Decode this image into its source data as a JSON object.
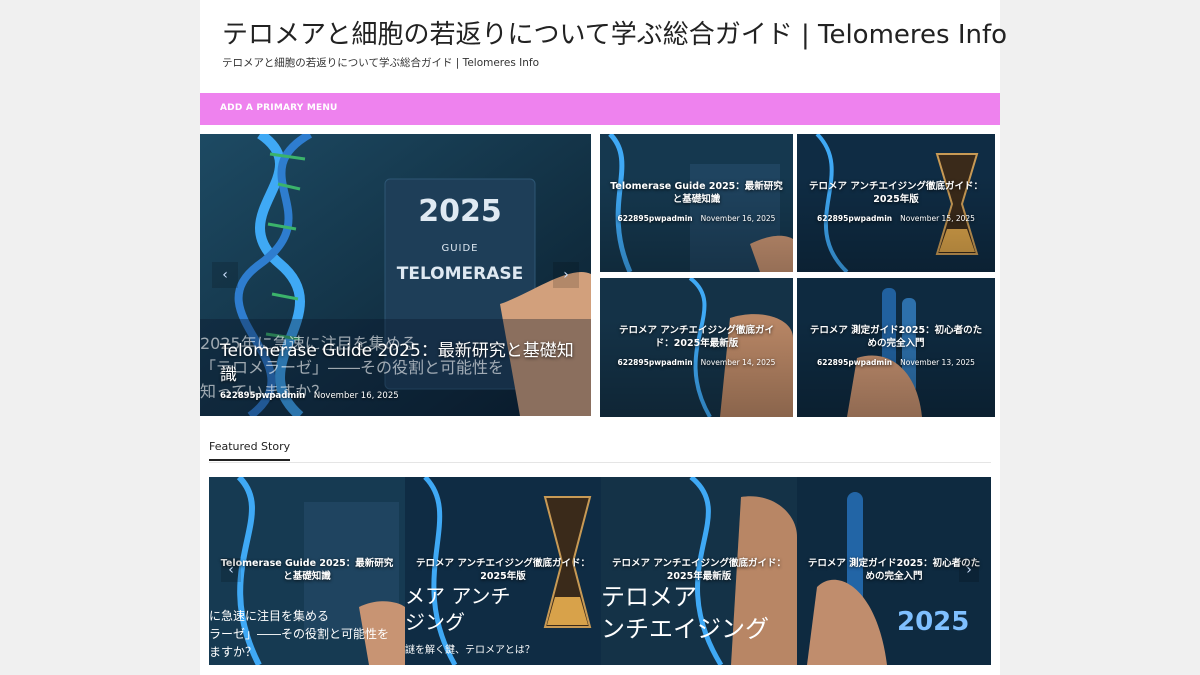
{
  "site": {
    "title": "テロメアと細胞の若返りについて学ぶ総合ガイド | Telomeres Info",
    "description": "テロメアと細胞の若返りについて学ぶ総合ガイド | Telomeres Info"
  },
  "menu": {
    "label": "ADD A PRIMARY MENU"
  },
  "colors": {
    "menu_bar": "#ee82ee",
    "page_bg": "#f0f0f0"
  },
  "hero": {
    "title": "Telomerase Guide 2025：最新研究と基礎知識",
    "author": "622895pwpadmin",
    "date": "November 16, 2025",
    "book_year": "2025",
    "book_guide": "GUIDE",
    "book_name": "TELOMERASE",
    "overlay_line1": "2025年に急速に注目を集める",
    "overlay_line2": "「テロメラーゼ」――その役割と可能性を",
    "overlay_line3": "知っていますか？"
  },
  "grid": [
    {
      "title": "Telomerase Guide 2025：最新研究と基礎知識",
      "author": "622895pwpadmin",
      "date": "November 16, 2025"
    },
    {
      "title": "テロメア アンチエイジング徹底ガイド：2025年版",
      "author": "622895pwpadmin",
      "date": "November 15, 2025"
    },
    {
      "title": "テロメア アンチエイジング徹底ガイド：2025年最新版",
      "author": "622895pwpadmin",
      "date": "November 14, 2025"
    },
    {
      "title": "テロメア 測定ガイド2025：初心者のための完全入門",
      "author": "622895pwpadmin",
      "date": "November 13, 2025"
    }
  ],
  "featured": {
    "heading": "Featured Story",
    "items": [
      {
        "title": "Telomerase Guide 2025：最新研究と基礎知識",
        "caption1": "に急速に注目を集める",
        "caption2": "ラーゼ」――その役割と可能性を",
        "caption3": "ますか？"
      },
      {
        "title": "テロメア アンチエイジング徹底ガイド：2025年版",
        "caption1": "メア アンチ",
        "caption2": "ジング",
        "caption3": "謎を解く鍵、テロメアとは？"
      },
      {
        "title": "テロメア アンチエイジング徹底ガイド：2025年最新版",
        "caption1": "テロメア",
        "caption2": "ンチエイジング"
      },
      {
        "title": "テロメア 測定ガイド2025：初心者のための完全入門",
        "caption1": "2025"
      }
    ]
  },
  "icons": {
    "prev": "chevron-left-icon",
    "next": "chevron-right-icon"
  }
}
